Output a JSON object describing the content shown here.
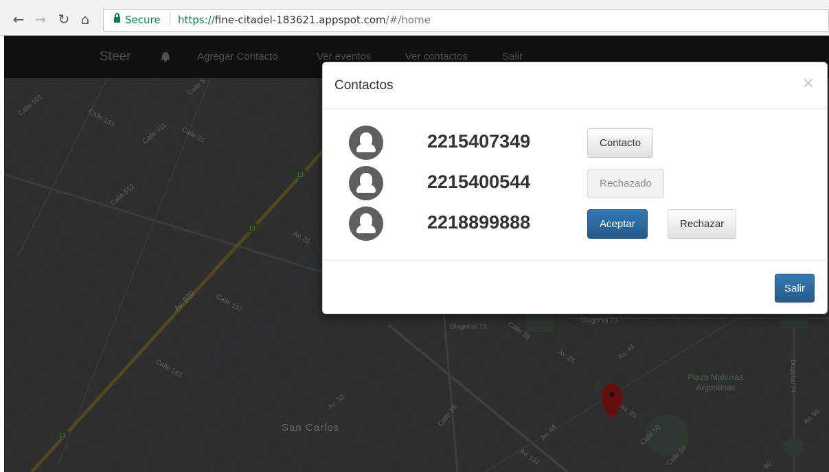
{
  "browser": {
    "secure_label": "Secure",
    "url_scheme": "https://",
    "url_host": "fine-citadel-183621.appspot.com",
    "url_path": "/#/home"
  },
  "navbar": {
    "brand": "Steer",
    "links": [
      "Agregar Contacto",
      "Ver eventos",
      "Ver contactos",
      "Salir"
    ]
  },
  "map": {
    "labels": {
      "calle501": "Calle 501",
      "calle5": "Calle 5",
      "calle133": "Calle 133",
      "calle511": "Calle 511",
      "calle31": "Calle 31",
      "calle512": "Calle 512",
      "route13": "13",
      "av31": "Av. 31",
      "av520": "Av. 520",
      "calle137": "Calle 137",
      "calle143": "Calle 143",
      "av32": "Av. 32",
      "san_carlos": "San Carlos",
      "calle38": "Calle 38",
      "av44": "Av. 44",
      "av131": "Av. 131",
      "diagonal73": "Diagonal 73",
      "calle26": "Calle 26",
      "av25": "Av. 25",
      "plaza": "Plaza Malvinas",
      "plaza2": "Argentinas",
      "diagonal74": "Diagonal 74",
      "av60": "Av. 60",
      "calle50": "Calle 50",
      "calle54": "Calle 54",
      "n60": "60"
    },
    "colors": {
      "base": "#5d5d5d",
      "highway": "#9c8f45",
      "marker": "#c5221f"
    }
  },
  "modal": {
    "title": "Contactos",
    "close_symbol": "×",
    "contacts": [
      {
        "phone": "2215407349",
        "buttons": [
          "Contacto"
        ]
      },
      {
        "phone": "2215400544",
        "buttons": [
          "Rechazado"
        ]
      },
      {
        "phone": "2218899888",
        "buttons": [
          "Aceptar",
          "Rechazar"
        ]
      }
    ],
    "footer_button": "Salir"
  }
}
